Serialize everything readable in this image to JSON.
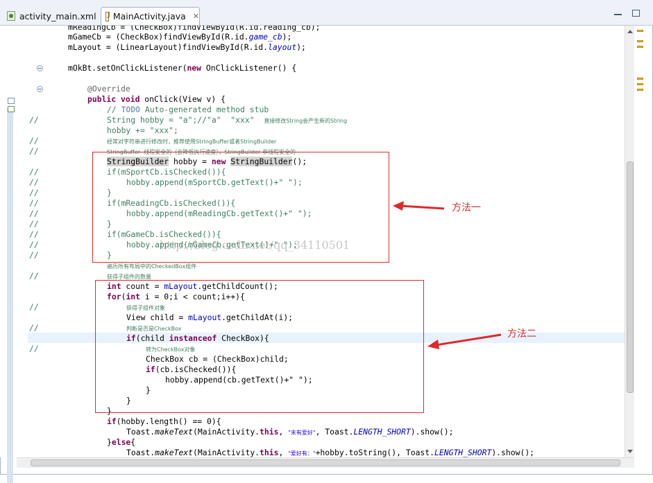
{
  "tabs": [
    {
      "label": "activity_main.xml",
      "icon": "xml-file-icon",
      "active": false
    },
    {
      "label": "MainActivity.java",
      "icon": "java-file-icon",
      "active": true
    }
  ],
  "tab_close_glyph": "✕",
  "annotations": {
    "method1": "方法一",
    "method2": "方法二",
    "watermark": "http://blog.csdn.net/qq_34110501",
    "color": "#e02828"
  },
  "comment_marker": "//",
  "code": {
    "l0": {
      "a": "mReadingCb = (CheckBox)findViewById(R.id.reading_cb);"
    },
    "l1": {
      "a": "mGameCb = (CheckBox)findViewById(R.id.",
      "b": "game_cb",
      "c": ");"
    },
    "l2": {
      "a": "mLayout = (LinearLayout)findViewById(R.id.",
      "b": "layout",
      "c": ");"
    },
    "l4": {
      "a": "mOkBt.setOnClickListener(",
      "b": "new",
      "c": " OnClickListener() {"
    },
    "l6": {
      "a": "@Override"
    },
    "l7": {
      "a": "public",
      "b": "void",
      "c": " onClick(View v) {"
    },
    "l8": {
      "a": "// ",
      "b": "TODO",
      "c": " Auto-generated method stub"
    },
    "l9": {
      "a": "String hobby = \"a\";//\"a\"  \"xxx\"  ",
      "b": "直接修改String会产生新的String"
    },
    "l10": {
      "a": "hobby += \"xxx\";"
    },
    "l11": {
      "a": "经常对字符串进行修改时，推荐使用StringBuffer或者StringBuilder"
    },
    "l12": {
      "a": "StringBuffer  线程安全的（会降低执行速度），StringBuilder 非线程安全的"
    },
    "l13": {
      "a": "StringBuilder",
      "b": " hobby = ",
      "c": "new",
      "d": " ",
      "e": "StringBuilder",
      "f": "();"
    },
    "l14": {
      "a": "if(mSportCb.isChecked()){"
    },
    "l15": {
      "a": "hobby.append(mSportCb.getText()+\" \");"
    },
    "l16": {
      "a": "}"
    },
    "l17": {
      "a": "if(mReadingCb.isChecked()){"
    },
    "l18": {
      "a": "hobby.append(mReadingCb.getText()+\" \");"
    },
    "l19": {
      "a": "}"
    },
    "l20": {
      "a": "if(mGameCb.isChecked()){"
    },
    "l21": {
      "a": "hobby.append(mGameCb.getText()+\" \");"
    },
    "l22": {
      "a": "}"
    },
    "l23": {
      "a": "遍历所有布局中的CheckedBox组件"
    },
    "l24": {
      "a": "获得子组件的数量"
    },
    "l25": {
      "a": "int",
      "b": " count = ",
      "c": "mLayout",
      "d": ".getChildCount();"
    },
    "l26": {
      "a": "for",
      "b": "(",
      "c": "int",
      "d": " i = 0;i < count;i++){"
    },
    "l27": {
      "a": "获得子组件对象"
    },
    "l28": {
      "a": "View child = ",
      "b": "mLayout",
      "c": ".getChildAt(i);"
    },
    "l29": {
      "a": "判断是否是CheckBox"
    },
    "l30": {
      "a": "if",
      "b": "(child ",
      "c": "instanceof",
      "d": " CheckBox){"
    },
    "l31": {
      "a": "转为CheckBox对象"
    },
    "l32": {
      "a": "CheckBox cb = (CheckBox)child;"
    },
    "l33": {
      "a": "if",
      "b": "(cb.isChecked()){"
    },
    "l34": {
      "a": "hobby.append(cb.getText()+\" \");"
    },
    "l35": {
      "a": "}"
    },
    "l36": {
      "a": "}"
    },
    "l37": {
      "a": "}"
    },
    "l38": {
      "a": "if",
      "b": "(hobby.length() == 0){"
    },
    "l39": {
      "a": "Toast.",
      "b": "makeText",
      "c": "(MainActivity.",
      "d": "this",
      "e": ", ",
      "f": "\"未有爱好\"",
      "g": ", Toast.",
      "h": "LENGTH_SHORT",
      "i": ").show();"
    },
    "l40": {
      "a": "}",
      "b": "else",
      "c": "{"
    },
    "l41": {
      "a": "Toast.",
      "b": "makeText",
      "c": "(MainActivity.",
      "d": "this",
      "e": ", ",
      "f": "\"爱好有：\"",
      "g": "+hobby.toString(), Toast.",
      "h": "LENGTH_SHORT",
      "i": ").show();"
    }
  }
}
